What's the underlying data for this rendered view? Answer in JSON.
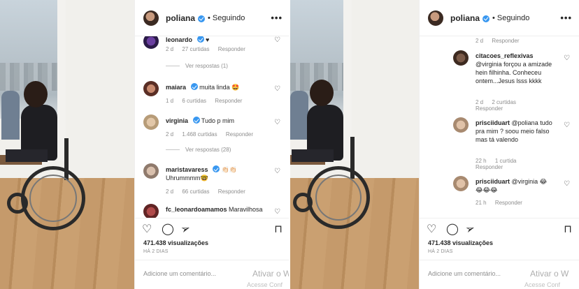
{
  "colors": {
    "verified_blue": "#3897f0",
    "muted_text": "#8e8e8e",
    "border": "#efefef",
    "text": "#262626"
  },
  "left": {
    "header": {
      "username": "poliana",
      "dot": "•",
      "follow_state": "Seguindo",
      "more_icon": "more-horizontal-icon"
    },
    "comments": [
      {
        "user": "leonardo",
        "verified": true,
        "text": "♥",
        "meta": {
          "age": "2 d",
          "likes": "27 curtidas",
          "reply": "Responder"
        },
        "view_replies": "Ver respostas (1)"
      },
      {
        "user": "maiara",
        "verified": true,
        "text": "muita linda 🤩",
        "meta": {
          "age": "1 d",
          "likes": "6 curtidas",
          "reply": "Responder"
        }
      },
      {
        "user": "virginia",
        "verified": true,
        "text": "Tudo p mim",
        "meta": {
          "age": "2 d",
          "likes": "1.468 curtidas",
          "reply": "Responder"
        },
        "view_replies": "Ver respostas (28)"
      },
      {
        "user": "maristavaress",
        "verified": true,
        "text": "👏🏻👏🏻",
        "text2": "Uhrummmm🤓",
        "meta": {
          "age": "2 d",
          "likes": "66 curtidas",
          "reply": "Responder"
        }
      },
      {
        "user": "fc_leonardoamamos",
        "verified": false,
        "text": "Maravilhosa"
      }
    ],
    "views": "471.438 visualizações",
    "date": "HÁ 2 DIAS",
    "add_comment_placeholder": "Adicione um comentário...",
    "watermark": "Ativar o W",
    "watermark2": "Acesse Conf"
  },
  "right": {
    "header": {
      "username": "poliana",
      "dot": "•",
      "follow_state": "Seguindo",
      "more_icon": "more-horizontal-icon"
    },
    "top_meta": {
      "age": "2 d",
      "reply": "Responder"
    },
    "comments": [
      {
        "user": "citacoes_reflexivas",
        "text": "@virginia forçou a amizade hein filhinha. Conheceu ontem...Jesus lsss kkkk",
        "meta": {
          "age": "2 d",
          "likes": "2 curtidas",
          "reply": "Responder"
        }
      },
      {
        "user": "prisciiduart",
        "text": "@poliana tudo pra mim ? soou meio falso mas tá valendo",
        "meta": {
          "age": "22 h",
          "likes": "1 curtida",
          "reply": "Responder"
        }
      },
      {
        "user": "prisciiduart",
        "text": "@virginia 😂😂😂😂",
        "meta": {
          "age": "21 h",
          "reply": "Responder"
        }
      }
    ],
    "views": "471.438 visualizações",
    "date": "HÁ 2 DIAS",
    "add_comment_placeholder": "Adicione um comentário...",
    "watermark": "Ativar o W",
    "watermark2": "Acesse Conf"
  }
}
